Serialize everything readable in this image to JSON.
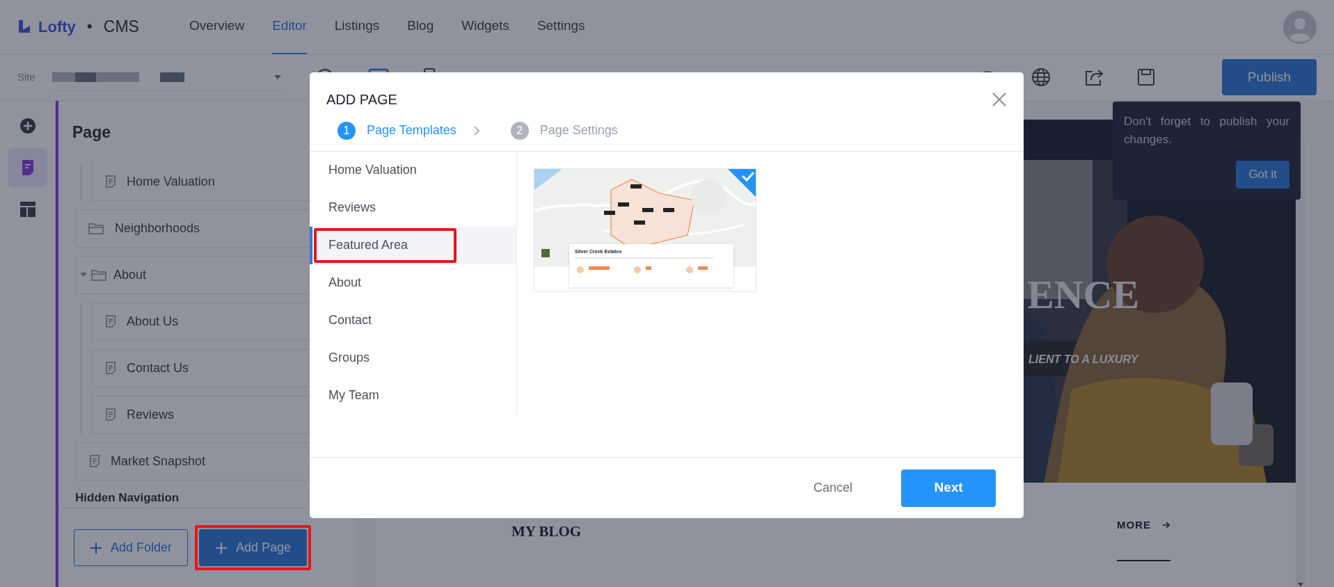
{
  "app": {
    "logo": "Lofty",
    "separator": "•",
    "product": "CMS"
  },
  "nav_tabs": [
    {
      "label": "Overview",
      "selected": false
    },
    {
      "label": "Editor",
      "selected": true
    },
    {
      "label": "Listings",
      "selected": false
    },
    {
      "label": "Blog",
      "selected": false
    },
    {
      "label": "Widgets",
      "selected": false
    },
    {
      "label": "Settings",
      "selected": false
    }
  ],
  "toolbar": {
    "site_label": "Site",
    "publish": "Publish"
  },
  "publish_tip": {
    "text": "Don't forget to publish your changes.",
    "button": "Got it"
  },
  "rail": [
    {
      "kind": "add",
      "selected": false
    },
    {
      "kind": "pages",
      "selected": true
    },
    {
      "kind": "layout",
      "selected": false
    }
  ],
  "sidebar": {
    "title": "Page",
    "tree": [
      {
        "children": [
          {
            "label": "Home Valuation",
            "kind": "page"
          }
        ]
      },
      {
        "label": "Neighborhoods",
        "kind": "folder"
      },
      {
        "label": "About",
        "kind": "folder",
        "expanded": true,
        "children": [
          {
            "label": "About Us",
            "kind": "page"
          },
          {
            "label": "Contact Us",
            "kind": "page"
          },
          {
            "label": "Reviews",
            "kind": "page"
          }
        ]
      },
      {
        "label": "Market Snapshot",
        "kind": "page"
      }
    ],
    "section_heading": "Hidden Navigation",
    "buttons": [
      {
        "label": "Add Folder",
        "kind": "outline"
      },
      {
        "label": "Add Page",
        "kind": "primary",
        "highlighted": true
      }
    ]
  },
  "preview": {
    "hero_heading": "ENCE",
    "hero_subtitle": "LIENT TO A LUXURY",
    "blog_heading": "MY BLOG",
    "more_link": "MORE"
  },
  "modal": {
    "title": "ADD PAGE",
    "steps": [
      {
        "number": "1",
        "label": "Page Templates",
        "selected": true
      },
      {
        "number": "2",
        "label": "Page Settings",
        "selected": false
      }
    ],
    "categories": [
      {
        "label": "Home Valuation",
        "selected": false,
        "highlighted": false
      },
      {
        "label": "Reviews",
        "selected": false,
        "highlighted": false
      },
      {
        "label": "Featured Area",
        "selected": true,
        "highlighted": true
      },
      {
        "label": "About",
        "selected": false,
        "highlighted": false
      },
      {
        "label": "Contact",
        "selected": false,
        "highlighted": false
      },
      {
        "label": "Groups",
        "selected": false,
        "highlighted": false
      },
      {
        "label": "My Team",
        "selected": false,
        "highlighted": false
      }
    ],
    "templates": [
      {
        "title": "Silver Creek Estates",
        "selected": true
      }
    ],
    "cancel": "Cancel",
    "next": "Next"
  }
}
